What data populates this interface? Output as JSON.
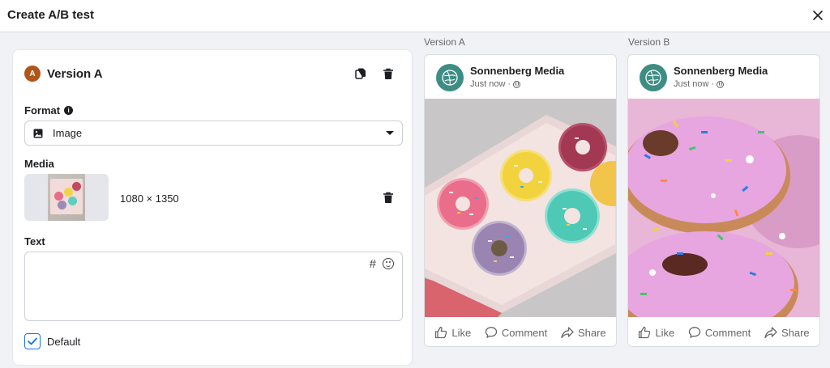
{
  "header": {
    "title": "Create A/B test"
  },
  "editor": {
    "version_badge": "A",
    "version_title": "Version A",
    "format_label": "Format",
    "format_info": "i",
    "format_value": "Image",
    "media_label": "Media",
    "media_size": "1080 × 1350",
    "text_label": "Text",
    "text_value": "",
    "hashtag_symbol": "#",
    "default_label": "Default",
    "default_checked": true
  },
  "previews": [
    {
      "label": "Version A",
      "page_name": "Sonnenberg Media",
      "timestamp": "Just now",
      "separator": "·",
      "image_subject": "box-of-sprinkled-donuts",
      "actions": {
        "like": "Like",
        "comment": "Comment",
        "share": "Share"
      }
    },
    {
      "label": "Version B",
      "page_name": "Sonnenberg Media",
      "timestamp": "Just now",
      "separator": "·",
      "image_subject": "closeup-pink-sprinkled-donuts",
      "actions": {
        "like": "Like",
        "comment": "Comment",
        "share": "Share"
      }
    }
  ],
  "colors": {
    "accent": "#1b74e4",
    "version_badge": "#b0561a",
    "page_avatar": "#3d8d84"
  }
}
